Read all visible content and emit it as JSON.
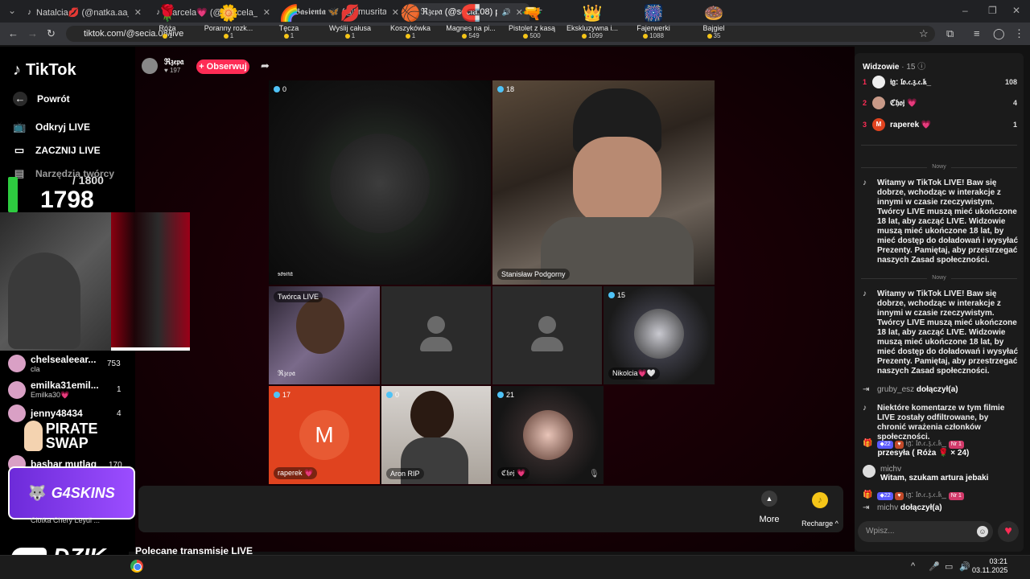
{
  "browser": {
    "tabs": [
      {
        "title": "Natalcia💋 (@natka.aa_) prowa...",
        "active": false
      },
      {
        "title": "Marcela💗 (@marcela_rozum) |...",
        "active": false
      },
      {
        "title": "𝕭𝖆𝖘𝖎𝖊𝖓𝖙𝖆 🦋 (@timusrita) |...",
        "active": false
      },
      {
        "title": "ℜ𝔷𝔢𝔭𝔞 (@secia.08) prowadz...",
        "active": true
      }
    ],
    "url": "tiktok.com/@secia.08/live"
  },
  "sidebar": {
    "logo": "TikTok",
    "back": "Powrót",
    "items": [
      {
        "label": "Odkryj LIVE",
        "icon": "tv-icon"
      },
      {
        "label": "ZACZNIJ LIVE",
        "icon": "camera-icon"
      },
      {
        "label": "Narzędzia twórcy",
        "icon": "tools-icon"
      }
    ]
  },
  "overlay": {
    "goal_target": "/ 1800",
    "goal_count": "1798",
    "goal_progress": 0.999,
    "gifters": [
      {
        "name": "chelsealeear...",
        "sub": "cla",
        "value": "753"
      },
      {
        "name": "emilka31emil...",
        "sub": "Emilka30💗",
        "value": "1"
      },
      {
        "name": "jenny48434",
        "sub": "",
        "value": "4"
      },
      {
        "name": "bashar mutlaq",
        "sub": "",
        "value": "170"
      },
      {
        "name": "Ciotka Chery Leydi ...",
        "sub": "",
        "value": ""
      }
    ],
    "brand_pirate": "PIRATE SWAP",
    "brand_g4": "G4SKINS",
    "brand_dzik": "DZIK"
  },
  "host": {
    "name": "ℜ𝔷𝔢𝔭𝔞",
    "likes": "197",
    "follow": "+ Obserwuj"
  },
  "tiles": [
    {
      "count": "0",
      "label": "𝔰𝔬𝔰𝔫𝔞"
    },
    {
      "count": "18",
      "label": "Stanisław Podgorny"
    },
    {
      "count": "",
      "label": "ℜ𝔷𝔢𝔭𝔞",
      "top_label": "Twórca LIVE"
    },
    {
      "count": "15",
      "label": "Nikolcia💗🤍"
    },
    {
      "count": "17",
      "label": "raperek 💗",
      "initial": "M"
    },
    {
      "count": "0",
      "label": "Aron RIP"
    },
    {
      "count": "21",
      "label": "ℭ𝔥𝔬𝔧 💗"
    }
  ],
  "gifts": [
    {
      "name": "Róża",
      "price": "1",
      "icon": "🌹"
    },
    {
      "name": "Poranny rozk...",
      "price": "1",
      "icon": "🌼"
    },
    {
      "name": "Tęcza",
      "price": "1",
      "icon": "🌈"
    },
    {
      "name": "Wyślij całusa",
      "price": "1",
      "icon": "💋"
    },
    {
      "name": "Koszykówka",
      "price": "1",
      "icon": "🏀"
    },
    {
      "name": "Magnes na pi...",
      "price": "549",
      "icon": "🧲"
    },
    {
      "name": "Pistolet z kasą",
      "price": "500",
      "icon": "🔫"
    },
    {
      "name": "Ekskluzywna i...",
      "price": "1099",
      "icon": "👑"
    },
    {
      "name": "Fajerwerki",
      "price": "1088",
      "icon": "🎆"
    },
    {
      "name": "Bajgiel",
      "price": "35",
      "icon": "🍩"
    }
  ],
  "gift_more": "More",
  "recharge": "Recharge",
  "recommended": "Polecane transmisje LIVE",
  "chat": {
    "viewers_title": "Widzowie",
    "viewers_count": "· 15",
    "top": [
      {
        "rank": "1",
        "name": "𝔦𝔤: 𝔩𝔬.𝔠.𝔷.𝔠.𝔨_",
        "value": "108"
      },
      {
        "rank": "2",
        "name": "ℭ𝔥𝔬𝔧 💗",
        "value": "4"
      },
      {
        "rank": "3",
        "name": "raperek 💗",
        "value": "1"
      }
    ],
    "divider": "Nowy",
    "welcome": "Witamy w TikTok LIVE! Baw się dobrze, wchodząc w interakcje z innymi w czasie rzeczywistym. Twórcy LIVE muszą mieć ukończone 18 lat, aby zacząć LIVE. Widzowie muszą mieć ukończone 18 lat, by mieć dostęp do doładowań i wysyłać Prezenty. Pamiętaj, aby przestrzegać naszych Zasad społeczności.",
    "join1_user": "gruby_esz",
    "join_text": "dołączył(a)",
    "filter_notice": "Niektóre komentarze w tym filmie LIVE zostały odfiltrowane, by chronić wrażenia członków społeczności.",
    "gift_badge_level": "22",
    "gift_badge_rank": "Nr 1",
    "gift_user": "𝔦𝔤: 𝔩𝔬.𝔠.𝔷.𝔠.𝔨_",
    "gift_text": "przesyła ( Róża 🌹 × 24)",
    "comment_user": "michv",
    "comment_text": "Witam, szukam artura jebaki",
    "join2_user": "michv",
    "input_placeholder": "Wpisz..."
  },
  "taskbar": {
    "time": "03:21",
    "date": "03.11.2025"
  }
}
